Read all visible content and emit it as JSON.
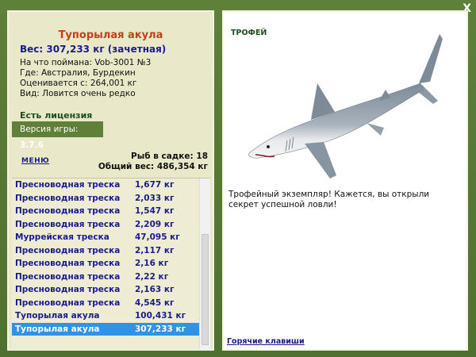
{
  "window": {
    "close_label": "X"
  },
  "fish": {
    "name": "Тупорылая акула",
    "weight": "Вес: 307,233 кг (зачетная)",
    "bait": "На что поймана: Vob-3001 №3",
    "where": "Где: Австралия, Бурдекин",
    "valued": "Оценивается с: 264,001 кг",
    "kind": "Вид: Ловится очень редко"
  },
  "license": "Есть лицензия",
  "version": {
    "label": "Версия игры:",
    "value": "3.7.6"
  },
  "menu_label": "МЕНЮ",
  "tank": {
    "count": "Рыб в садке: 18",
    "total": "Общий вес: 486,354 кг"
  },
  "catch_list": [
    {
      "name": "Пресноводная треска",
      "weight": "1,677 кг"
    },
    {
      "name": "Пресноводная треска",
      "weight": "2,033 кг"
    },
    {
      "name": "Пресноводная треска",
      "weight": "1,547 кг"
    },
    {
      "name": "Пресноводная треска",
      "weight": "2,209 кг"
    },
    {
      "name": "Муррейская треска",
      "weight": "47,095 кг"
    },
    {
      "name": "Пресноводная треска",
      "weight": "2,117 кг"
    },
    {
      "name": "Пресноводная треска",
      "weight": "2,16 кг"
    },
    {
      "name": "Пресноводная треска",
      "weight": "2,22 кг"
    },
    {
      "name": "Пресноводная треска",
      "weight": "2,163 кг"
    },
    {
      "name": "Пресноводная треска",
      "weight": "4,545 кг"
    },
    {
      "name": "Тупорылая акула",
      "weight": "100,431 кг"
    },
    {
      "name": "Тупорылая акула",
      "weight": "307,233 кг"
    }
  ],
  "selected_index": 11,
  "trophy": {
    "title": "ТРОФЕЙ",
    "description": "Трофейный экземпляр! Кажется, вы открыли секрет успешной ловли!"
  },
  "hotkeys_label": "Горячие клавиши",
  "colors": {
    "panel": "#e9e8c9",
    "frame": "#5a7a37",
    "accent": "#c0411b",
    "selection": "#2f93e8"
  }
}
